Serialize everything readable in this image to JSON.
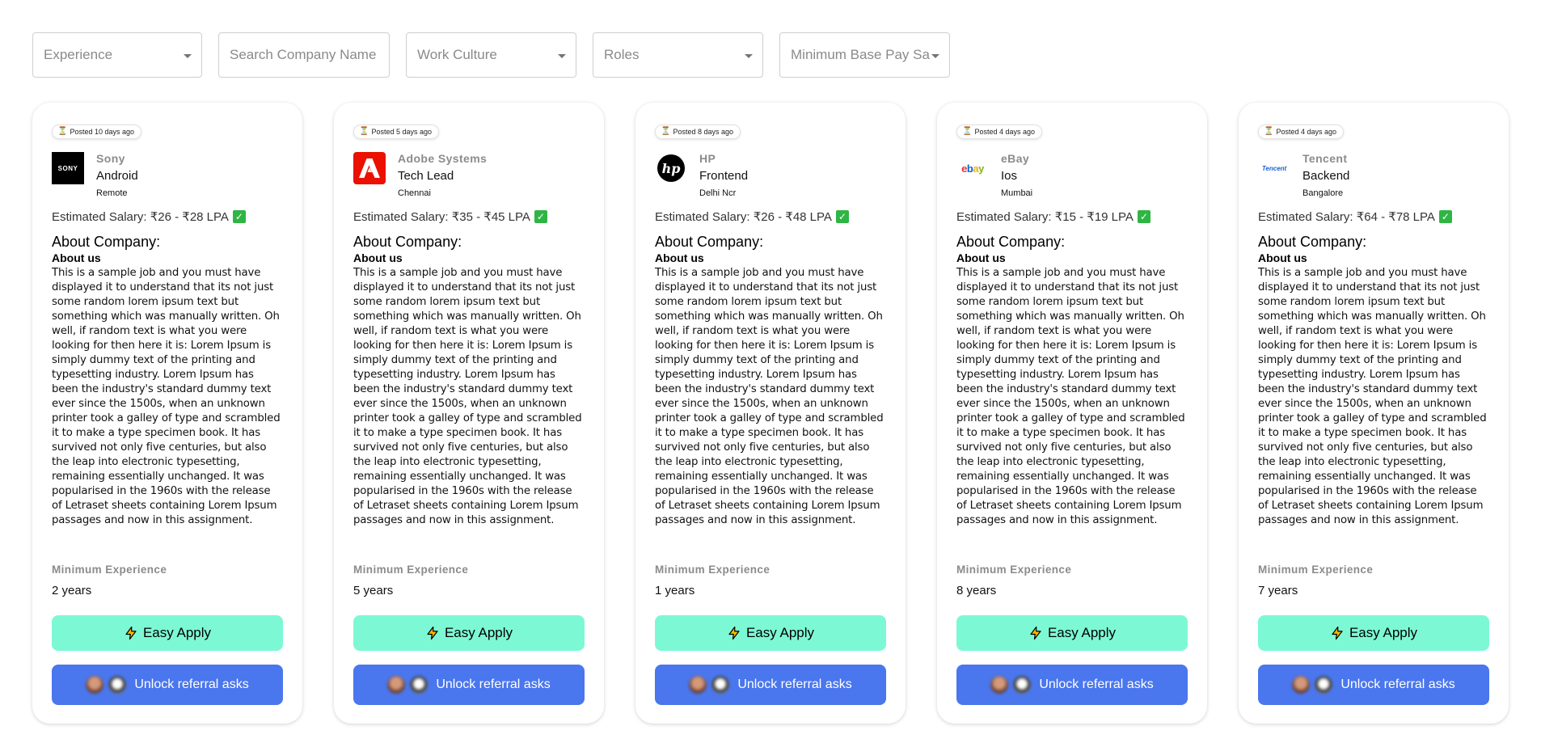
{
  "filters": {
    "experience": "Experience",
    "search_placeholder": "Search Company Name",
    "work_culture": "Work Culture",
    "roles": "Roles",
    "min_base_pay": "Minimum Base Pay Salary"
  },
  "common": {
    "about_title": "About Company:",
    "about_sub": "About us",
    "about_body": "This is a sample job and you must have displayed it to understand that its not just some random lorem ipsum text but something which was manually written. Oh well, if random text is what you were looking for then here it is: Lorem Ipsum is simply dummy text of the printing and typesetting industry. Lorem Ipsum has been the industry's standard dummy text ever since the 1500s, when an unknown printer took a galley of type and scrambled it to make a type specimen book. It has survived not only five centuries, but also the leap into electronic typesetting, remaining essentially unchanged. It was popularised in the 1960s with the release of Letraset sheets containing Lorem Ipsum passages and now in this assignment.",
    "min_exp_label": "Minimum Experience",
    "easy_apply": "Easy Apply",
    "unlock_referral": "Unlock referral asks"
  },
  "jobs": [
    {
      "posted": "Posted 10 days ago",
      "company": "Sony",
      "logo": "SONY",
      "role": "Android",
      "location": "Remote",
      "salary": "Estimated Salary: ₹26 - ₹28 LPA",
      "min_exp": "2 years"
    },
    {
      "posted": "Posted 5 days ago",
      "company": "Adobe Systems",
      "logo": "adobe-logo",
      "role": "Tech Lead",
      "location": "Chennai",
      "salary": "Estimated Salary: ₹35 - ₹45 LPA",
      "min_exp": "5 years"
    },
    {
      "posted": "Posted 8 days ago",
      "company": "HP",
      "logo": "hp-logo",
      "role": "Frontend",
      "location": "Delhi Ncr",
      "salary": "Estimated Salary: ₹26 - ₹48 LPA",
      "min_exp": "1 years"
    },
    {
      "posted": "Posted 4 days ago",
      "company": "eBay",
      "logo": "ebay",
      "role": "Ios",
      "location": "Mumbai",
      "salary": "Estimated Salary: ₹15 - ₹19 LPA",
      "min_exp": "8 years"
    },
    {
      "posted": "Posted 4 days ago",
      "company": "Tencent",
      "logo": "Tencent",
      "role": "Backend",
      "location": "Bangalore",
      "salary": "Estimated Salary: ₹64 - ₹78 LPA",
      "min_exp": "7 years"
    }
  ],
  "colors": {
    "easy_apply_bg": "#7cf9d4",
    "referral_bg": "#4a76ee",
    "verified_check": "#2fb544",
    "adobe_red": "#eb1000"
  }
}
